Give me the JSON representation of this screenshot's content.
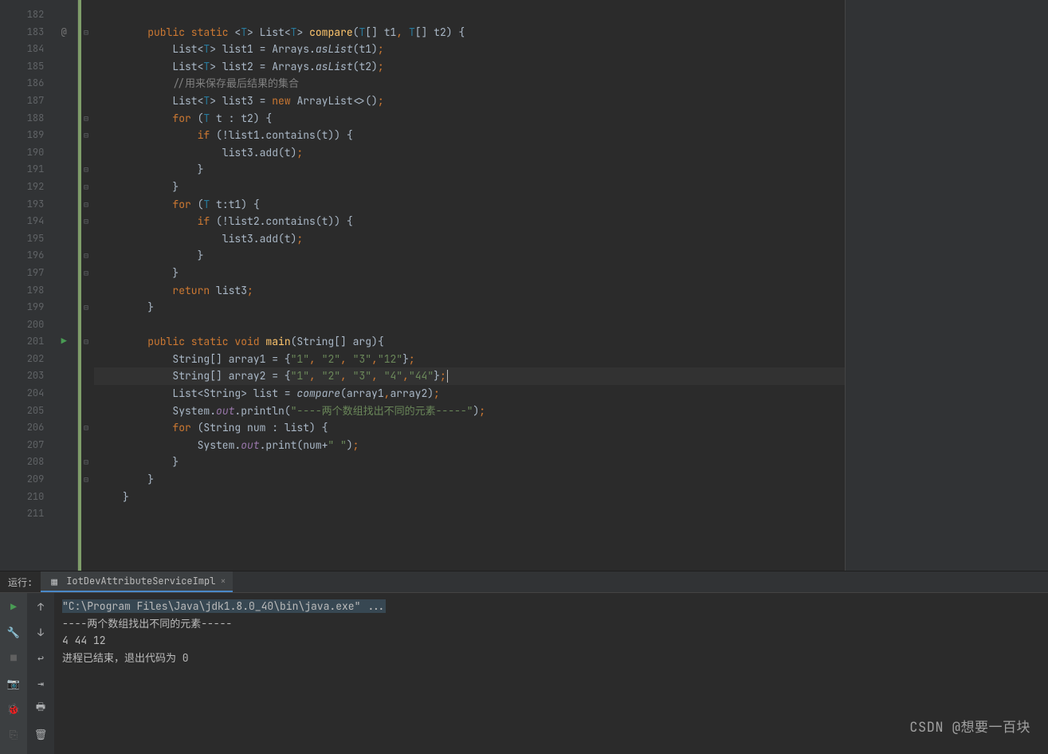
{
  "gutter": {
    "start": 182,
    "end": 211,
    "run_line": 201,
    "at_line": 183,
    "fold_open_lines": [
      183,
      188,
      189,
      193,
      194,
      201,
      206
    ],
    "fold_close_lines": [
      191,
      192,
      196,
      197,
      199,
      208,
      209
    ]
  },
  "code": {
    "current_line": 203,
    "lines": [
      {
        "n": 182,
        "tokens": []
      },
      {
        "n": 183,
        "tokens": [
          {
            "t": "    ",
            "c": ""
          },
          {
            "t": "public static",
            "c": "kw"
          },
          {
            "t": " <",
            "c": ""
          },
          {
            "t": "T",
            "c": "type"
          },
          {
            "t": "> List<",
            "c": ""
          },
          {
            "t": "T",
            "c": "type"
          },
          {
            "t": "> ",
            "c": ""
          },
          {
            "t": "compare",
            "c": "mname"
          },
          {
            "t": "(",
            "c": ""
          },
          {
            "t": "T",
            "c": "type"
          },
          {
            "t": "[] t1",
            "c": "param"
          },
          {
            "t": ",",
            "c": "kw"
          },
          {
            "t": " ",
            "c": ""
          },
          {
            "t": "T",
            "c": "type"
          },
          {
            "t": "[] t2) {",
            "c": ""
          }
        ]
      },
      {
        "n": 184,
        "tokens": [
          {
            "t": "        List<",
            "c": ""
          },
          {
            "t": "T",
            "c": "type"
          },
          {
            "t": "> list1 = Arrays.",
            "c": ""
          },
          {
            "t": "asList",
            "c": "static-call"
          },
          {
            "t": "(t1)",
            "c": ""
          },
          {
            "t": ";",
            "c": "kw"
          }
        ]
      },
      {
        "n": 185,
        "tokens": [
          {
            "t": "        List<",
            "c": ""
          },
          {
            "t": "T",
            "c": "type"
          },
          {
            "t": "> list2 = Arrays.",
            "c": ""
          },
          {
            "t": "asList",
            "c": "static-call"
          },
          {
            "t": "(t2)",
            "c": ""
          },
          {
            "t": ";",
            "c": "kw"
          }
        ]
      },
      {
        "n": 186,
        "tokens": [
          {
            "t": "        ",
            "c": ""
          },
          {
            "t": "//用来保存最后结果的集合",
            "c": "cmt"
          }
        ]
      },
      {
        "n": 187,
        "tokens": [
          {
            "t": "        List<",
            "c": ""
          },
          {
            "t": "T",
            "c": "type"
          },
          {
            "t": "> list3 = ",
            "c": ""
          },
          {
            "t": "new",
            "c": "kw"
          },
          {
            "t": " ArrayList<>()",
            "c": ""
          },
          {
            "t": ";",
            "c": "kw"
          }
        ]
      },
      {
        "n": 188,
        "tokens": [
          {
            "t": "        ",
            "c": ""
          },
          {
            "t": "for",
            "c": "kw"
          },
          {
            "t": " (",
            "c": ""
          },
          {
            "t": "T",
            "c": "type"
          },
          {
            "t": " t : t2) {",
            "c": ""
          }
        ]
      },
      {
        "n": 189,
        "tokens": [
          {
            "t": "            ",
            "c": ""
          },
          {
            "t": "if",
            "c": "kw"
          },
          {
            "t": " (!list1.contains(t)) {",
            "c": ""
          }
        ]
      },
      {
        "n": 190,
        "tokens": [
          {
            "t": "                list3.add(t)",
            "c": ""
          },
          {
            "t": ";",
            "c": "kw"
          }
        ]
      },
      {
        "n": 191,
        "tokens": [
          {
            "t": "            }",
            "c": ""
          }
        ]
      },
      {
        "n": 192,
        "tokens": [
          {
            "t": "        }",
            "c": ""
          }
        ]
      },
      {
        "n": 193,
        "tokens": [
          {
            "t": "        ",
            "c": ""
          },
          {
            "t": "for",
            "c": "kw"
          },
          {
            "t": " (",
            "c": ""
          },
          {
            "t": "T",
            "c": "type"
          },
          {
            "t": " t:t1) {",
            "c": ""
          }
        ]
      },
      {
        "n": 194,
        "tokens": [
          {
            "t": "            ",
            "c": ""
          },
          {
            "t": "if",
            "c": "kw"
          },
          {
            "t": " (!list2.contains(t)) {",
            "c": ""
          }
        ]
      },
      {
        "n": 195,
        "tokens": [
          {
            "t": "                list3.add(t)",
            "c": ""
          },
          {
            "t": ";",
            "c": "kw"
          }
        ]
      },
      {
        "n": 196,
        "tokens": [
          {
            "t": "            }",
            "c": ""
          }
        ]
      },
      {
        "n": 197,
        "tokens": [
          {
            "t": "        }",
            "c": ""
          }
        ]
      },
      {
        "n": 198,
        "tokens": [
          {
            "t": "        ",
            "c": ""
          },
          {
            "t": "return",
            "c": "kw"
          },
          {
            "t": " list3",
            "c": ""
          },
          {
            "t": ";",
            "c": "kw"
          }
        ]
      },
      {
        "n": 199,
        "tokens": [
          {
            "t": "    }",
            "c": ""
          }
        ]
      },
      {
        "n": 200,
        "tokens": []
      },
      {
        "n": 201,
        "tokens": [
          {
            "t": "    ",
            "c": ""
          },
          {
            "t": "public static void",
            "c": "kw"
          },
          {
            "t": " ",
            "c": ""
          },
          {
            "t": "main",
            "c": "mname"
          },
          {
            "t": "(String[] arg){",
            "c": ""
          }
        ]
      },
      {
        "n": 202,
        "tokens": [
          {
            "t": "        String[] array1 = {",
            "c": ""
          },
          {
            "t": "\"1\"",
            "c": "str"
          },
          {
            "t": ",",
            "c": "kw"
          },
          {
            "t": " ",
            "c": ""
          },
          {
            "t": "\"2\"",
            "c": "str"
          },
          {
            "t": ",",
            "c": "kw"
          },
          {
            "t": " ",
            "c": ""
          },
          {
            "t": "\"3\"",
            "c": "str"
          },
          {
            "t": ",",
            "c": "kw"
          },
          {
            "t": "\"12\"",
            "c": "str"
          },
          {
            "t": "}",
            "c": ""
          },
          {
            "t": ";",
            "c": "kw"
          }
        ]
      },
      {
        "n": 203,
        "tokens": [
          {
            "t": "        String[] array2 = {",
            "c": ""
          },
          {
            "t": "\"1\"",
            "c": "str"
          },
          {
            "t": ",",
            "c": "kw"
          },
          {
            "t": " ",
            "c": ""
          },
          {
            "t": "\"2\"",
            "c": "str"
          },
          {
            "t": ",",
            "c": "kw"
          },
          {
            "t": " ",
            "c": ""
          },
          {
            "t": "\"3\"",
            "c": "str"
          },
          {
            "t": ",",
            "c": "kw"
          },
          {
            "t": " ",
            "c": ""
          },
          {
            "t": "\"4\"",
            "c": "str"
          },
          {
            "t": ",",
            "c": "kw"
          },
          {
            "t": "\"44\"",
            "c": "str"
          },
          {
            "t": "}",
            "c": ""
          },
          {
            "t": ";",
            "c": "kw"
          }
        ]
      },
      {
        "n": 204,
        "tokens": [
          {
            "t": "        List<String> list = ",
            "c": ""
          },
          {
            "t": "compare",
            "c": "static-call"
          },
          {
            "t": "(array1",
            "c": ""
          },
          {
            "t": ",",
            "c": "kw"
          },
          {
            "t": "array2)",
            "c": ""
          },
          {
            "t": ";",
            "c": "kw"
          }
        ]
      },
      {
        "n": 205,
        "tokens": [
          {
            "t": "        System.",
            "c": ""
          },
          {
            "t": "out",
            "c": "static-field"
          },
          {
            "t": ".println(",
            "c": ""
          },
          {
            "t": "\"----两个数组找出不同的元素-----\"",
            "c": "str"
          },
          {
            "t": ")",
            "c": ""
          },
          {
            "t": ";",
            "c": "kw"
          }
        ]
      },
      {
        "n": 206,
        "tokens": [
          {
            "t": "        ",
            "c": ""
          },
          {
            "t": "for",
            "c": "kw"
          },
          {
            "t": " (String num : list) {",
            "c": ""
          }
        ]
      },
      {
        "n": 207,
        "tokens": [
          {
            "t": "            System.",
            "c": ""
          },
          {
            "t": "out",
            "c": "static-field"
          },
          {
            "t": ".print(num+",
            "c": ""
          },
          {
            "t": "\" \"",
            "c": "str"
          },
          {
            "t": ")",
            "c": ""
          },
          {
            "t": ";",
            "c": "kw"
          }
        ]
      },
      {
        "n": 208,
        "tokens": [
          {
            "t": "        }",
            "c": ""
          }
        ]
      },
      {
        "n": 209,
        "tokens": [
          {
            "t": "    }",
            "c": ""
          }
        ]
      },
      {
        "n": 210,
        "tokens": [
          {
            "t": "}",
            "c": ""
          }
        ]
      },
      {
        "n": 211,
        "tokens": []
      }
    ]
  },
  "run": {
    "label": "运行:",
    "tab_name": "IotDevAttributeServiceImpl",
    "console": [
      {
        "text": "\"C:\\Program Files\\Java\\jdk1.8.0_40\\bin\\java.exe\" ...",
        "cls": "cmd"
      },
      {
        "text": "----两个数组找出不同的元素-----",
        "cls": ""
      },
      {
        "text": "4 44 12",
        "cls": ""
      },
      {
        "text": "进程已结束，退出代码为 0",
        "cls": ""
      }
    ]
  },
  "watermark": "CSDN @想要一百块"
}
